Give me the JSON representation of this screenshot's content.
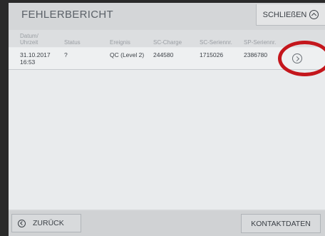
{
  "header": {
    "title": "FEHLERBERICHT",
    "close_label": "SCHLIEßEN"
  },
  "table": {
    "columns": [
      "Datum/\nUhrzeit",
      "Status",
      "Ereignis",
      "SC-Charge",
      "SC-Seriennr.",
      "SP-Seriennr."
    ],
    "rows": [
      {
        "datum": "31.10.2017",
        "zeit": "16:53",
        "status": "?",
        "ereignis": "QC (Level 2)",
        "sc_charge": "244580",
        "sc_seriennr": "1715026",
        "sp_seriennr": "2386780"
      }
    ]
  },
  "footer": {
    "back_label": "ZURÜCK",
    "contact_label": "KONTAKTDATEN"
  },
  "colors": {
    "highlight_circle": "#c4161c"
  },
  "icons": {
    "close": "chevron-up-circle-icon",
    "row": "chevron-right-circle-icon",
    "back": "chevron-left-circle-icon"
  }
}
